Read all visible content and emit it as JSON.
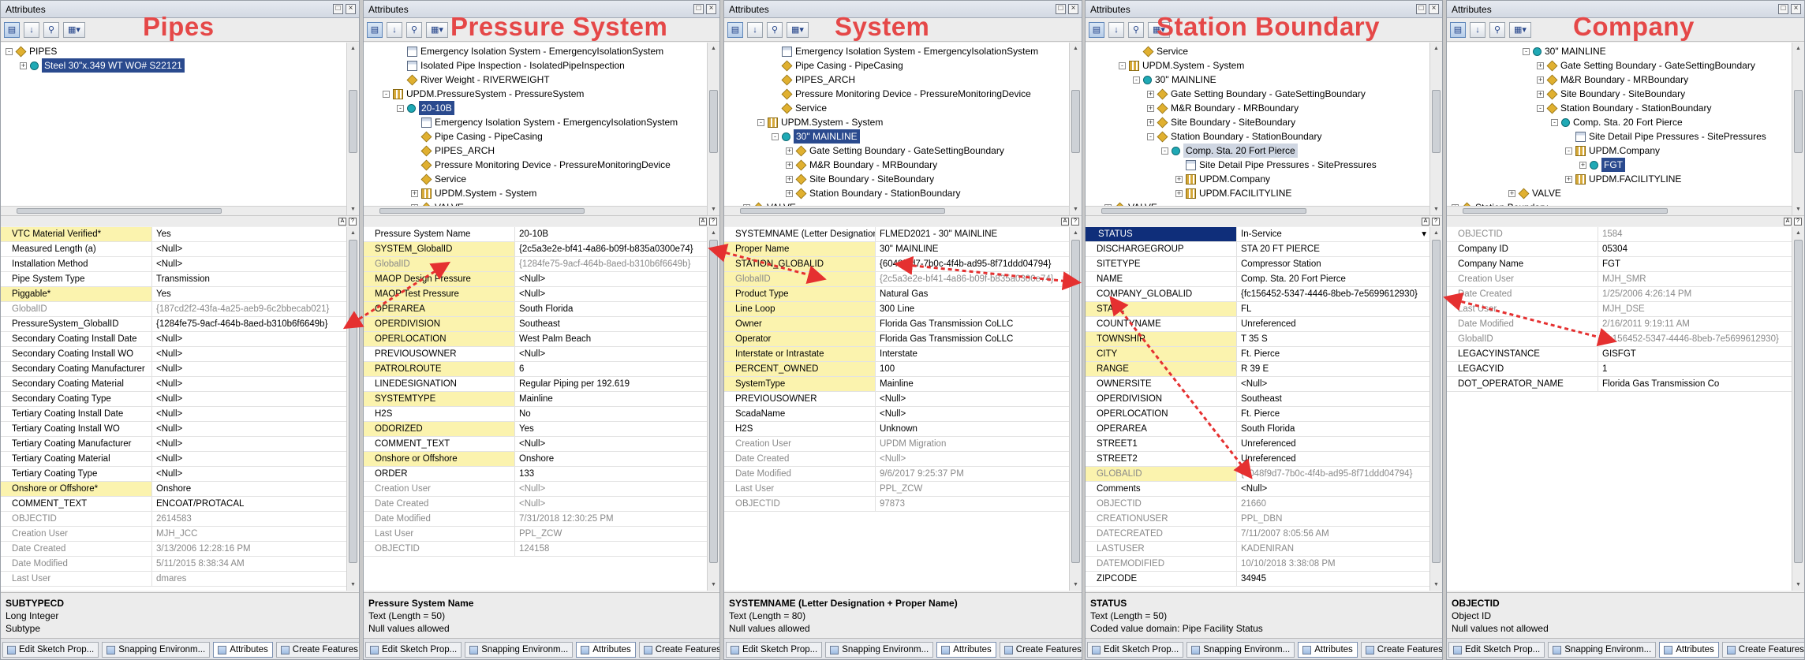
{
  "window_title": "Attributes",
  "panels": [
    {
      "heading": "Pipes",
      "tree": [
        {
          "indent": 0,
          "exp": "-",
          "icon": "dia",
          "label": "PIPES"
        },
        {
          "indent": 1,
          "exp": "+",
          "icon": "cyl",
          "label": "Steel 30\"x.349 WT   WO# S22121",
          "sel": true
        }
      ],
      "rows": [
        {
          "k": "VTC Material Verified*",
          "v": "Yes",
          "y": true
        },
        {
          "k": "Measured Length (a)",
          "v": "<Null>"
        },
        {
          "k": "Installation Method",
          "v": "<Null>"
        },
        {
          "k": "Pipe System Type",
          "v": "Transmission"
        },
        {
          "k": "Piggable*",
          "v": "Yes",
          "y": true
        },
        {
          "k": "GlobalID",
          "v": "{187cd2f2-43fa-4a25-aeb9-6c2bbecab021}",
          "ro": true
        },
        {
          "k": "PressureSystem_GlobalID",
          "v": "{1284fe75-9acf-464b-8aed-b310b6f6649b}"
        },
        {
          "k": "Secondary Coating  Install Date",
          "v": "<Null>"
        },
        {
          "k": "Secondary Coating Install WO",
          "v": "<Null>"
        },
        {
          "k": "Secondary Coating Manufacturer",
          "v": "<Null>"
        },
        {
          "k": "Secondary Coating Material",
          "v": "<Null>"
        },
        {
          "k": "Secondary Coating Type",
          "v": "<Null>"
        },
        {
          "k": "Tertiary Coating  Install Date",
          "v": "<Null>"
        },
        {
          "k": "Tertiary Coating Install WO",
          "v": "<Null>"
        },
        {
          "k": "Tertiary Coating Manufacturer",
          "v": "<Null>"
        },
        {
          "k": "Tertiary Coating Material",
          "v": "<Null>"
        },
        {
          "k": "Tertiary Coating Type",
          "v": "<Null>"
        },
        {
          "k": "Onshore or Offshore*",
          "v": "Onshore",
          "y": true
        },
        {
          "k": "COMMENT_TEXT",
          "v": "ENCOAT/PROTACAL"
        },
        {
          "k": "OBJECTID",
          "v": "2614583",
          "ro": true
        },
        {
          "k": "Creation User",
          "v": "MJH_JCC",
          "ro": true
        },
        {
          "k": "Date Created",
          "v": "3/13/2006 12:28:16 PM",
          "ro": true
        },
        {
          "k": "Date Modified",
          "v": "5/11/2015 8:38:34 AM",
          "ro": true
        },
        {
          "k": "Last User",
          "v": "dmares",
          "ro": true
        }
      ],
      "desc": {
        "title": "SUBTYPECD",
        "line1": "Long Integer",
        "line2": "Subtype"
      }
    },
    {
      "heading": "Pressure System",
      "tree": [
        {
          "indent": 2,
          "exp": "",
          "icon": "tbl",
          "label": "Emergency Isolation System - EmergencyIsolationSystem"
        },
        {
          "indent": 2,
          "exp": "",
          "icon": "tbl",
          "label": "Isolated Pipe Inspection - IsolatedPipeInspection"
        },
        {
          "indent": 2,
          "exp": "",
          "icon": "dia",
          "label": "River Weight - RIVERWEIGHT"
        },
        {
          "indent": 1,
          "exp": "-",
          "icon": "lay",
          "label": "UPDM.PressureSystem - PressureSystem"
        },
        {
          "indent": 2,
          "exp": "-",
          "icon": "cyl",
          "label": "20-10B",
          "sel": true
        },
        {
          "indent": 3,
          "exp": "",
          "icon": "tbl",
          "label": "Emergency Isolation System - EmergencyIsolationSystem"
        },
        {
          "indent": 3,
          "exp": "",
          "icon": "dia",
          "label": "Pipe Casing - PipeCasing"
        },
        {
          "indent": 3,
          "exp": "",
          "icon": "dia",
          "label": "PIPES_ARCH"
        },
        {
          "indent": 3,
          "exp": "",
          "icon": "dia",
          "label": "Pressure Monitoring Device - PressureMonitoringDevice"
        },
        {
          "indent": 3,
          "exp": "",
          "icon": "dia",
          "label": "Service"
        },
        {
          "indent": 3,
          "exp": "+",
          "icon": "lay",
          "label": "UPDM.System - System"
        },
        {
          "indent": 3,
          "exp": "+",
          "icon": "dia",
          "label": "VALVE"
        }
      ],
      "rows": [
        {
          "k": "Pressure System Name",
          "v": "20-10B"
        },
        {
          "k": "SYSTEM_GlobalID",
          "v": "{2c5a3e2e-bf41-4a86-b09f-b835a0300e74}",
          "y": true
        },
        {
          "k": "GlobalID",
          "v": "{1284fe75-9acf-464b-8aed-b310b6f6649b}",
          "y": true,
          "ro": true
        },
        {
          "k": "MAOP Design Pressure",
          "v": "<Null>",
          "y": true
        },
        {
          "k": "MAOP Test Pressure",
          "v": "<Null>",
          "y": true
        },
        {
          "k": "OPERAREA",
          "v": "South Florida",
          "y": true
        },
        {
          "k": "OPERDIVISION",
          "v": "Southeast",
          "y": true
        },
        {
          "k": "OPERLOCATION",
          "v": "West Palm Beach",
          "y": true
        },
        {
          "k": "PREVIOUSOWNER",
          "v": "<Null>"
        },
        {
          "k": "PATROLROUTE",
          "v": "6",
          "y": true
        },
        {
          "k": "LINEDESIGNATION",
          "v": "Regular Piping per 192.619"
        },
        {
          "k": "SYSTEMTYPE",
          "v": "Mainline",
          "y": true
        },
        {
          "k": "H2S",
          "v": "No"
        },
        {
          "k": "ODORIZED",
          "v": "Yes",
          "y": true
        },
        {
          "k": "COMMENT_TEXT",
          "v": "<Null>"
        },
        {
          "k": "Onshore or Offshore",
          "v": "Onshore",
          "y": true
        },
        {
          "k": "ORDER",
          "v": "133"
        },
        {
          "k": "Creation User",
          "v": "<Null>",
          "ro": true
        },
        {
          "k": "Date Created",
          "v": "<Null>",
          "ro": true
        },
        {
          "k": "Date Modified",
          "v": "7/31/2018 12:30:25 PM",
          "ro": true
        },
        {
          "k": "Last User",
          "v": "PPL_ZCW",
          "ro": true
        },
        {
          "k": "OBJECTID",
          "v": "124158",
          "ro": true
        }
      ],
      "desc": {
        "title": "Pressure System Name",
        "line1": "Text (Length = 50)",
        "line2": "Null values allowed"
      }
    },
    {
      "heading": "System",
      "tree": [
        {
          "indent": 3,
          "exp": "",
          "icon": "tbl",
          "label": "Emergency Isolation System - EmergencyIsolationSystem"
        },
        {
          "indent": 3,
          "exp": "",
          "icon": "dia",
          "label": "Pipe Casing - PipeCasing"
        },
        {
          "indent": 3,
          "exp": "",
          "icon": "dia",
          "label": "PIPES_ARCH"
        },
        {
          "indent": 3,
          "exp": "",
          "icon": "dia",
          "label": "Pressure Monitoring Device - PressureMonitoringDevice"
        },
        {
          "indent": 3,
          "exp": "",
          "icon": "dia",
          "label": "Service"
        },
        {
          "indent": 2,
          "exp": "-",
          "icon": "lay",
          "label": "UPDM.System - System"
        },
        {
          "indent": 3,
          "exp": "-",
          "icon": "cyl",
          "label": "30\" MAINLINE",
          "sel": true
        },
        {
          "indent": 4,
          "exp": "+",
          "icon": "dia",
          "label": "Gate Setting Boundary - GateSettingBoundary"
        },
        {
          "indent": 4,
          "exp": "+",
          "icon": "dia",
          "label": "M&R Boundary - MRBoundary"
        },
        {
          "indent": 4,
          "exp": "+",
          "icon": "dia",
          "label": "Site Boundary - SiteBoundary"
        },
        {
          "indent": 4,
          "exp": "+",
          "icon": "dia",
          "label": "Station Boundary - StationBoundary"
        },
        {
          "indent": 1,
          "exp": "+",
          "icon": "dia",
          "label": "VALVE"
        }
      ],
      "rows": [
        {
          "k": "SYSTEMNAME (Letter Designation +",
          "v": "FLMED2021 - 30\" MAINLINE"
        },
        {
          "k": "Proper Name",
          "v": "30\" MAINLINE",
          "y": true
        },
        {
          "k": "STATION_GLOBALID",
          "v": "{6048f9d7-7b0c-4f4b-ad95-8f71ddd04794}",
          "y": true
        },
        {
          "k": "GlobalID",
          "v": "{2c5a3e2e-bf41-4a86-b09f-b835a0300e74}",
          "y": true,
          "ro": true
        },
        {
          "k": "Product Type",
          "v": "Natural Gas",
          "y": true
        },
        {
          "k": "Line Loop",
          "v": "300 Line",
          "y": true
        },
        {
          "k": "Owner",
          "v": "Florida Gas Transmission CoLLC",
          "y": true
        },
        {
          "k": "Operator",
          "v": "Florida Gas Transmission CoLLC",
          "y": true
        },
        {
          "k": "Interstate or Intrastate",
          "v": "Interstate",
          "y": true
        },
        {
          "k": "PERCENT_OWNED",
          "v": "100",
          "y": true
        },
        {
          "k": "SystemType",
          "v": "Mainline",
          "y": true
        },
        {
          "k": "PREVIOUSOWNER",
          "v": "<Null>"
        },
        {
          "k": "ScadaName",
          "v": "<Null>"
        },
        {
          "k": "H2S",
          "v": "Unknown"
        },
        {
          "k": "Creation User",
          "v": "UPDM Migration",
          "ro": true
        },
        {
          "k": "Date Created",
          "v": "<Null>",
          "ro": true
        },
        {
          "k": "Date Modified",
          "v": "9/6/2017 9:25:37 PM",
          "ro": true
        },
        {
          "k": "Last User",
          "v": "PPL_ZCW",
          "ro": true
        },
        {
          "k": "OBJECTID",
          "v": "97873",
          "ro": true
        }
      ],
      "desc": {
        "title": "SYSTEMNAME (Letter Designation + Proper Name)",
        "line1": "Text (Length = 80)",
        "line2": "Null values allowed"
      }
    },
    {
      "heading": "Station Boundary",
      "tree": [
        {
          "indent": 3,
          "exp": "",
          "icon": "dia",
          "label": "Service"
        },
        {
          "indent": 2,
          "exp": "-",
          "icon": "lay",
          "label": "UPDM.System - System"
        },
        {
          "indent": 3,
          "exp": "-",
          "icon": "cyl",
          "label": "30\" MAINLINE"
        },
        {
          "indent": 4,
          "exp": "+",
          "icon": "dia",
          "label": "Gate Setting Boundary - GateSettingBoundary"
        },
        {
          "indent": 4,
          "exp": "+",
          "icon": "dia",
          "label": "M&R Boundary - MRBoundary"
        },
        {
          "indent": 4,
          "exp": "+",
          "icon": "dia",
          "label": "Site Boundary - SiteBoundary"
        },
        {
          "indent": 4,
          "exp": "-",
          "icon": "dia",
          "label": "Station Boundary - StationBoundary"
        },
        {
          "indent": 5,
          "exp": "-",
          "icon": "cyl",
          "label": "Comp. Sta. 20 Fort Pierce",
          "selg": true
        },
        {
          "indent": 6,
          "exp": "",
          "icon": "tbl",
          "label": "Site Detail Pipe Pressures - SitePressures"
        },
        {
          "indent": 6,
          "exp": "+",
          "icon": "lay",
          "label": "UPDM.Company"
        },
        {
          "indent": 6,
          "exp": "+",
          "icon": "lay",
          "label": "UPDM.FACILITYLINE"
        },
        {
          "indent": 1,
          "exp": "+",
          "icon": "dia",
          "label": "VALVE"
        }
      ],
      "rows": [
        {
          "k": "STATUS",
          "v": "In-Service",
          "sel": true
        },
        {
          "k": "DISCHARGEGROUP",
          "v": "STA 20 FT PIERCE"
        },
        {
          "k": "SITETYPE",
          "v": "Compressor Station"
        },
        {
          "k": "NAME",
          "v": "Comp. Sta. 20 Fort Pierce"
        },
        {
          "k": "COMPANY_GLOBALID",
          "v": "{fc156452-5347-4446-8beb-7e5699612930}"
        },
        {
          "k": "STATE",
          "v": "FL",
          "y": true
        },
        {
          "k": "COUNTYNAME",
          "v": "Unreferenced"
        },
        {
          "k": "TOWNSHIP",
          "v": "T 35 S",
          "y": true
        },
        {
          "k": "CITY",
          "v": "Ft. Pierce",
          "y": true
        },
        {
          "k": "RANGE",
          "v": "R 39 E",
          "y": true
        },
        {
          "k": "OWNERSITE",
          "v": "<Null>"
        },
        {
          "k": "OPERDIVISION",
          "v": "Southeast"
        },
        {
          "k": "OPERLOCATION",
          "v": "Ft. Pierce"
        },
        {
          "k": "OPERAREA",
          "v": "South Florida"
        },
        {
          "k": "STREET1",
          "v": "Unreferenced"
        },
        {
          "k": "STREET2",
          "v": "Unreferenced"
        },
        {
          "k": "GLOBALID",
          "v": "{6048f9d7-7b0c-4f4b-ad95-8f71ddd04794}",
          "y": true,
          "ro": true
        },
        {
          "k": "Comments",
          "v": "<Null>"
        },
        {
          "k": "OBJECTID",
          "v": "21660",
          "ro": true
        },
        {
          "k": "CREATIONUSER",
          "v": "PPL_DBN",
          "ro": true
        },
        {
          "k": "DATECREATED",
          "v": "7/11/2007 8:05:56 AM",
          "ro": true
        },
        {
          "k": "LASTUSER",
          "v": "KADENIRAN",
          "ro": true
        },
        {
          "k": "DATEMODIFIED",
          "v": "10/10/2018 3:38:08 PM",
          "ro": true
        },
        {
          "k": "ZIPCODE",
          "v": "34945"
        }
      ],
      "desc": {
        "title": "STATUS",
        "line1": "Text (Length = 50)",
        "line2": "Coded value domain: Pipe Facility Status"
      }
    },
    {
      "heading": "Company",
      "tree": [
        {
          "indent": 5,
          "exp": "-",
          "icon": "cyl",
          "label": "30\" MAINLINE"
        },
        {
          "indent": 6,
          "exp": "+",
          "icon": "dia",
          "label": "Gate Setting Boundary - GateSettingBoundary"
        },
        {
          "indent": 6,
          "exp": "+",
          "icon": "dia",
          "label": "M&R Boundary - MRBoundary"
        },
        {
          "indent": 6,
          "exp": "+",
          "icon": "dia",
          "label": "Site Boundary - SiteBoundary"
        },
        {
          "indent": 6,
          "exp": "-",
          "icon": "dia",
          "label": "Station Boundary - StationBoundary"
        },
        {
          "indent": 7,
          "exp": "-",
          "icon": "cyl",
          "label": "Comp. Sta. 20 Fort Pierce"
        },
        {
          "indent": 8,
          "exp": "",
          "icon": "tbl",
          "label": "Site Detail Pipe Pressures - SitePressures"
        },
        {
          "indent": 8,
          "exp": "-",
          "icon": "lay",
          "label": "UPDM.Company"
        },
        {
          "indent": 9,
          "exp": "+",
          "icon": "cyl",
          "label": "FGT",
          "sel": true
        },
        {
          "indent": 8,
          "exp": "+",
          "icon": "lay",
          "label": "UPDM.FACILITYLINE"
        },
        {
          "indent": 4,
          "exp": "+",
          "icon": "dia",
          "label": "VALVE"
        },
        {
          "indent": 0,
          "exp": "+",
          "icon": "dia",
          "label": "Station Boundary"
        }
      ],
      "rows": [
        {
          "k": "OBJECTID",
          "v": "1584",
          "ro": true
        },
        {
          "k": "Company ID",
          "v": "05304"
        },
        {
          "k": "Company Name",
          "v": "FGT"
        },
        {
          "k": "Creation User",
          "v": "MJH_SMR",
          "ro": true
        },
        {
          "k": "Date Created",
          "v": "1/25/2006 4:26:14 PM",
          "ro": true
        },
        {
          "k": "Last User",
          "v": "MJH_DSE",
          "ro": true
        },
        {
          "k": "Date Modified",
          "v": "2/16/2011 9:19:11 AM",
          "ro": true
        },
        {
          "k": "GlobalID",
          "v": "{fc156452-5347-4446-8beb-7e5699612930}",
          "ro": true
        },
        {
          "k": "LEGACYINSTANCE",
          "v": "GISFGT"
        },
        {
          "k": "LEGACYID",
          "v": "1"
        },
        {
          "k": "DOT_OPERATOR_NAME",
          "v": "Florida Gas Transmission Co"
        }
      ],
      "desc": {
        "title": "OBJECTID",
        "line1": "Object ID",
        "line2": "Null values not allowed"
      }
    }
  ],
  "tabs": [
    "Edit Sketch Prop...",
    "Snapping Environm...",
    "Attributes",
    "Create Features"
  ],
  "colors": {
    "heading": "#e54848",
    "arrow": "#e53030",
    "required_field": "#fbf3ae",
    "selection": "#2a4a8e"
  }
}
